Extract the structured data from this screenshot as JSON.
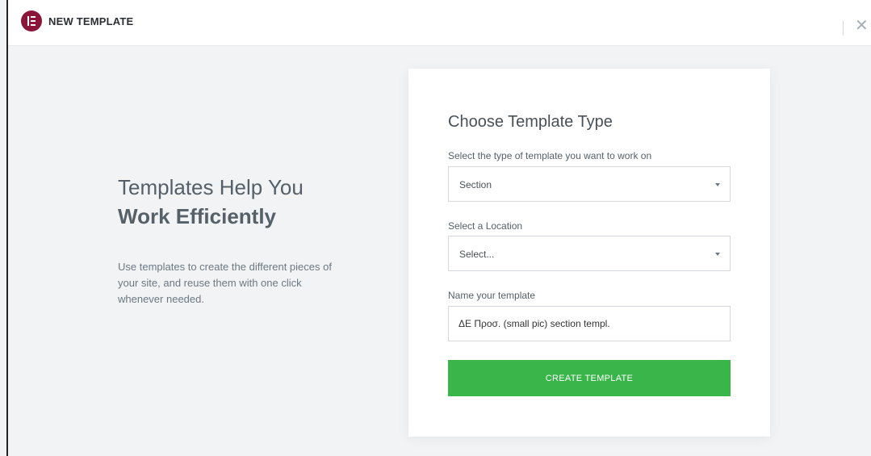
{
  "header": {
    "title": "NEW TEMPLATE",
    "close_icon": "✕",
    "logo_color": "#8a1538"
  },
  "intro": {
    "line1": "Templates Help You",
    "line2": "Work Efficiently",
    "description": "Use templates to create the different pieces of your site, and reuse them with one click whenever needed."
  },
  "form": {
    "title": "Choose Template Type",
    "type_label": "Select the type of template you want to work on",
    "type_value": "Section",
    "location_label": "Select a Location",
    "location_value": "Select...",
    "name_label": "Name your template",
    "name_value": "ΔΕ Προσ. (small pic) section templ.",
    "submit_label": "CREATE TEMPLATE",
    "submit_color": "#39b54a"
  }
}
